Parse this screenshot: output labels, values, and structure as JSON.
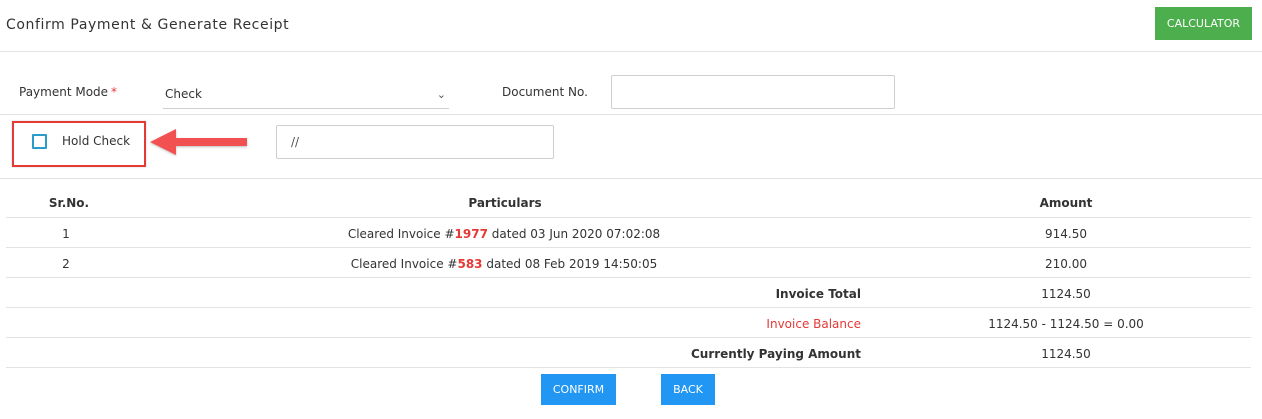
{
  "header": {
    "title": "Confirm Payment & Generate Receipt",
    "calculator_label": "CALCULATOR"
  },
  "form": {
    "payment_mode_label": "Payment Mode",
    "required_mark": "*",
    "payment_mode_value": "Check",
    "document_no_label": "Document No.",
    "document_no_value": "",
    "hold_check_label": "Hold Check",
    "hold_check_checked": false,
    "date_value": "//"
  },
  "table": {
    "headers": {
      "sr": "Sr.No.",
      "particulars": "Particulars",
      "amount": "Amount"
    },
    "rows": [
      {
        "sr": "1",
        "prefix": "Cleared Invoice #",
        "invoice": "1977",
        "suffix": " dated 03 Jun 2020 07:02:08",
        "amount": "914.50"
      },
      {
        "sr": "2",
        "prefix": "Cleared Invoice #",
        "invoice": "583",
        "suffix": " dated 08 Feb 2019 14:50:05",
        "amount": "210.00"
      }
    ],
    "summary": [
      {
        "label": "Invoice Total",
        "value": "1124.50"
      },
      {
        "label": "Invoice Balance",
        "value": "1124.50 - 1124.50 = 0.00"
      },
      {
        "label": "Currently Paying Amount",
        "value": "1124.50"
      }
    ]
  },
  "actions": {
    "confirm_label": "CONFIRM",
    "back_label": "BACK"
  },
  "colors": {
    "primary": "#2196f3",
    "success": "#4cae4c",
    "danger": "#e53935",
    "checkbox": "#2a9cc9"
  }
}
